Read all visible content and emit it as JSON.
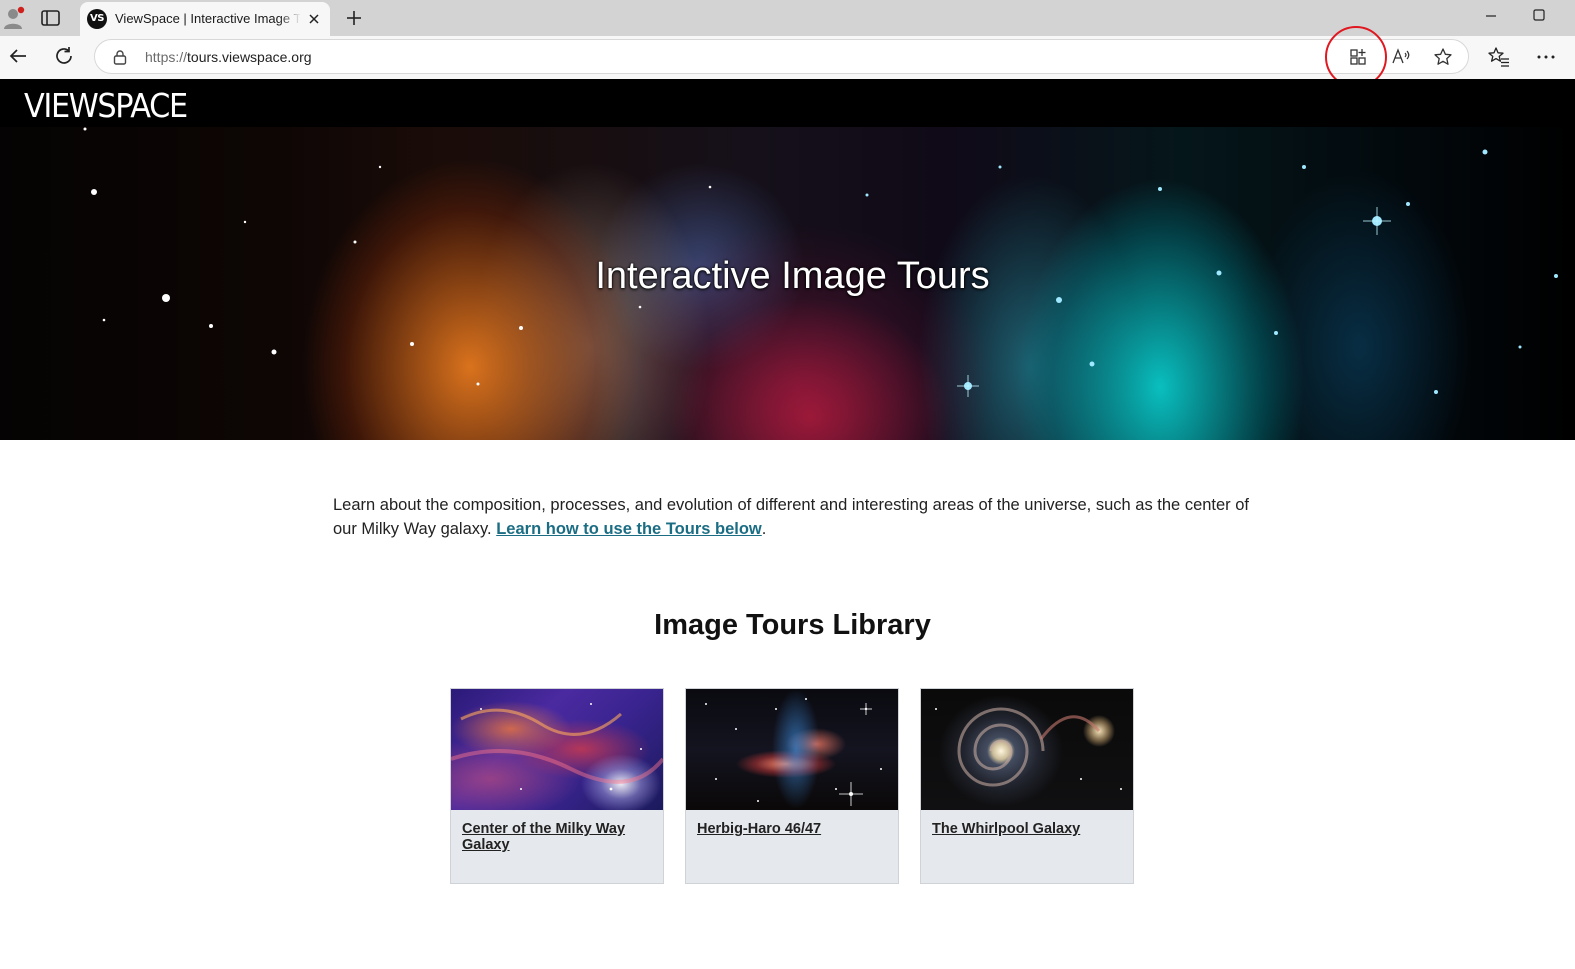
{
  "browser": {
    "tab_title": "ViewSpace | Interactive Image Tours",
    "favicon_text": "VS",
    "address_scheme": "https://",
    "address_host": "tours.viewspace.org"
  },
  "site": {
    "logo_text": "VIEWSPACE",
    "hero_title": "Interactive Image Tours",
    "intro_text": "Learn about the composition, processes, and evolution of different and interesting areas of the universe, such as the center of our Milky Way galaxy. ",
    "intro_link": "Learn how to use the Tours below",
    "intro_end": ".",
    "library_heading": "Image Tours Library",
    "tours": [
      {
        "label": "Center of the Milky Way Galaxy"
      },
      {
        "label": "Herbig-Haro 46/47"
      },
      {
        "label": "The Whirlpool Galaxy"
      }
    ]
  },
  "icons": {
    "profile": "profile-icon",
    "tab_actions": "tab-actions-icon",
    "close": "close-icon",
    "new_tab": "plus-icon",
    "back": "arrow-left-icon",
    "refresh": "refresh-icon",
    "lock": "lock-icon",
    "apps": "apps-icon",
    "read_aloud": "read-aloud-icon",
    "favorite": "star-icon",
    "favorites": "favorites-icon",
    "more": "more-icon"
  },
  "colors": {
    "accent_circle": "#e0181f",
    "link": "#1b6d84",
    "header": "#000000",
    "card_bg": "#e5e8ec"
  }
}
